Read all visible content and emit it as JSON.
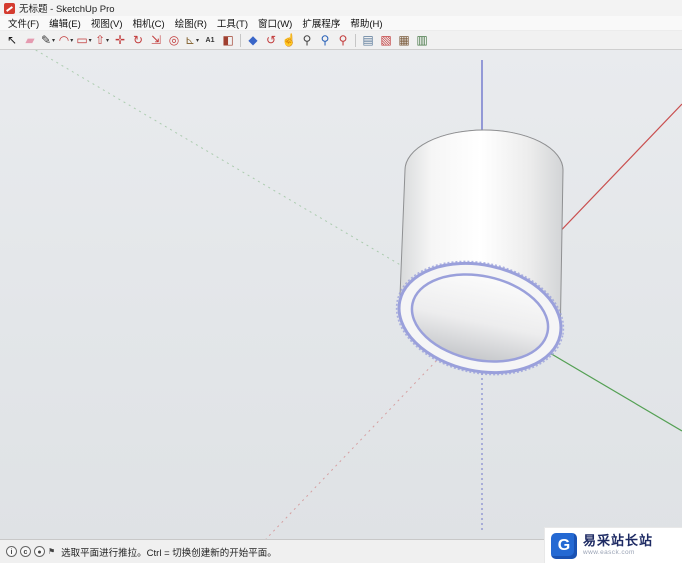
{
  "window": {
    "title": "无标题 - SketchUp Pro"
  },
  "menu": {
    "items": [
      "文件(F)",
      "编辑(E)",
      "视图(V)",
      "相机(C)",
      "绘图(R)",
      "工具(T)",
      "窗口(W)",
      "扩展程序",
      "帮助(H)"
    ]
  },
  "toolbar": {
    "tools": [
      {
        "name": "select",
        "glyph": "↖",
        "color": "#1a1a1a",
        "dropdown": false
      },
      {
        "name": "eraser",
        "glyph": "▰",
        "color": "#e59bb0",
        "dropdown": false
      },
      {
        "name": "line",
        "glyph": "✎",
        "color": "#3a3a3a",
        "dropdown": true
      },
      {
        "name": "arc",
        "glyph": "◠",
        "color": "#c23b3b",
        "dropdown": true
      },
      {
        "name": "shapes",
        "glyph": "▭",
        "color": "#c23b3b",
        "dropdown": true
      },
      {
        "name": "push-pull",
        "glyph": "⇧",
        "color": "#c23b3b",
        "dropdown": true
      },
      {
        "name": "move",
        "glyph": "✛",
        "color": "#c23b3b",
        "dropdown": false
      },
      {
        "name": "rotate",
        "glyph": "↻",
        "color": "#c23b3b",
        "dropdown": false
      },
      {
        "name": "scale",
        "glyph": "⇲",
        "color": "#c23b3b",
        "dropdown": false
      },
      {
        "name": "offset",
        "glyph": "◎",
        "color": "#c23b3b",
        "dropdown": false
      },
      {
        "name": "tape-measure",
        "glyph": "⊾",
        "color": "#8a6a3a",
        "dropdown": true
      },
      {
        "name": "text",
        "glyph": "A1",
        "color": "#333333",
        "dropdown": false
      },
      {
        "name": "paint-bucket",
        "glyph": "◧",
        "color": "#a04030",
        "dropdown": false
      },
      {
        "type": "sep"
      },
      {
        "name": "navigation",
        "glyph": "◆",
        "color": "#3a66c8",
        "dropdown": false
      },
      {
        "name": "orbit",
        "glyph": "↺",
        "color": "#c23b3b",
        "dropdown": false
      },
      {
        "name": "pan",
        "glyph": "☝",
        "color": "#b08968",
        "dropdown": false
      },
      {
        "name": "zoom",
        "glyph": "⚲",
        "color": "#444444",
        "dropdown": false
      },
      {
        "name": "zoom-window",
        "glyph": "⚲",
        "color": "#2a62b8",
        "dropdown": false
      },
      {
        "name": "zoom-extents",
        "glyph": "⚲",
        "color": "#c23b3b",
        "dropdown": false
      },
      {
        "type": "sep"
      },
      {
        "name": "section-plane",
        "glyph": "▤",
        "color": "#5a7a9a",
        "dropdown": false
      },
      {
        "name": "components",
        "glyph": "▧",
        "color": "#c23b3b",
        "dropdown": false
      },
      {
        "name": "materials",
        "glyph": "▦",
        "color": "#7a5a3a",
        "dropdown": false
      },
      {
        "name": "styles",
        "glyph": "▥",
        "color": "#4a7a4a",
        "dropdown": false
      }
    ]
  },
  "viewport": {
    "axes": {
      "red": "#c94f4f",
      "green": "#54a054",
      "blue": "#5b63c8"
    },
    "selection_color": "#9aa0db",
    "model": "cylinder-tube"
  },
  "statusbar": {
    "message": "选取平面进行推拉。Ctrl = 切换创建新的开始平面。",
    "icons": [
      {
        "name": "info-icon",
        "glyph": "i",
        "shape": "circle"
      },
      {
        "name": "credits-icon",
        "glyph": "c",
        "shape": "circle"
      },
      {
        "name": "user-icon",
        "glyph": "●",
        "shape": "circle"
      },
      {
        "name": "geolocation-icon",
        "glyph": "⚑",
        "shape": "plain"
      }
    ]
  },
  "watermark": {
    "title": "易采站长站",
    "subtitle": "www.easck.com",
    "logo_letter": "G",
    "logo_color": "#2469d3"
  }
}
